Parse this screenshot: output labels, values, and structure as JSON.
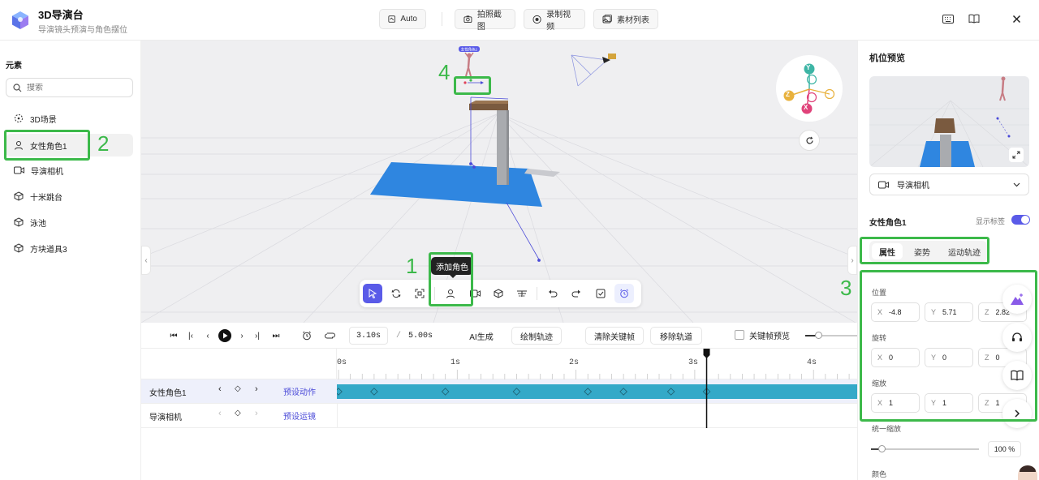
{
  "header": {
    "title": "3D导演台",
    "subtitle": "导演镜头预演与角色摆位",
    "auto_label": "Auto",
    "snapshot_label": "拍照截图",
    "record_label": "录制视频",
    "assets_label": "素材列表"
  },
  "sidebar": {
    "title": "元素",
    "search_placeholder": "搜索",
    "items": [
      {
        "label": "3D场景",
        "icon": "scene-icon"
      },
      {
        "label": "女性角色1",
        "icon": "person-icon"
      },
      {
        "label": "导演相机",
        "icon": "camera-icon"
      },
      {
        "label": "十米跳台",
        "icon": "cube-icon"
      },
      {
        "label": "泳池",
        "icon": "cube-icon"
      },
      {
        "label": "方块道具3",
        "icon": "cube-icon"
      }
    ]
  },
  "viewport": {
    "tooltip": "添加角色",
    "character_tag": "女性角色1",
    "gizmo_axes": [
      "Y",
      "Z",
      "X"
    ]
  },
  "annotations": [
    "1",
    "2",
    "3",
    "4"
  ],
  "playback": {
    "current_time": "3.10s",
    "separator": "/",
    "total_time": "5.00s",
    "ai_label": "AI生成",
    "draw_track_label": "绘制轨迹",
    "clear_keyframes_label": "清除关键帧",
    "remove_track_label": "移除轨道",
    "keyframe_preview_label": "关键帧预览"
  },
  "timeline": {
    "ruler": [
      "0s",
      "1s",
      "2s",
      "3s",
      "4s"
    ],
    "playhead_time": 3.1,
    "tracks": [
      {
        "name": "女性角色1",
        "preset": "预设动作"
      },
      {
        "name": "导演相机",
        "preset": "预设运镜"
      }
    ],
    "keyframes": [
      0,
      0.3,
      0.9,
      1.5,
      2.1,
      2.4,
      2.8,
      3.1
    ]
  },
  "right_panel": {
    "title": "机位预览",
    "camera_select": "导演相机",
    "section_title": "女性角色1",
    "show_label": "显示标签",
    "show_label_on": true,
    "tabs": [
      "属性",
      "姿势",
      "运动轨迹"
    ],
    "position_label": "位置",
    "position": {
      "x": "-4.8",
      "y": "5.71",
      "z": "2.82"
    },
    "rotation_label": "旋转",
    "rotation": {
      "x": "0",
      "y": "0",
      "z": "0"
    },
    "scale_label": "缩放",
    "scale": {
      "x": "1",
      "y": "1",
      "z": "1"
    },
    "uniform_scale_label": "统一缩放",
    "uniform_scale_value": "100 %",
    "color_label": "颜色",
    "axis_x": "X",
    "axis_y": "Y",
    "axis_z": "Z"
  },
  "colors": {
    "accent": "#5a5be8",
    "annotation": "#3cb94a",
    "track": "#34a9c8",
    "pool": "#2f86e0"
  }
}
